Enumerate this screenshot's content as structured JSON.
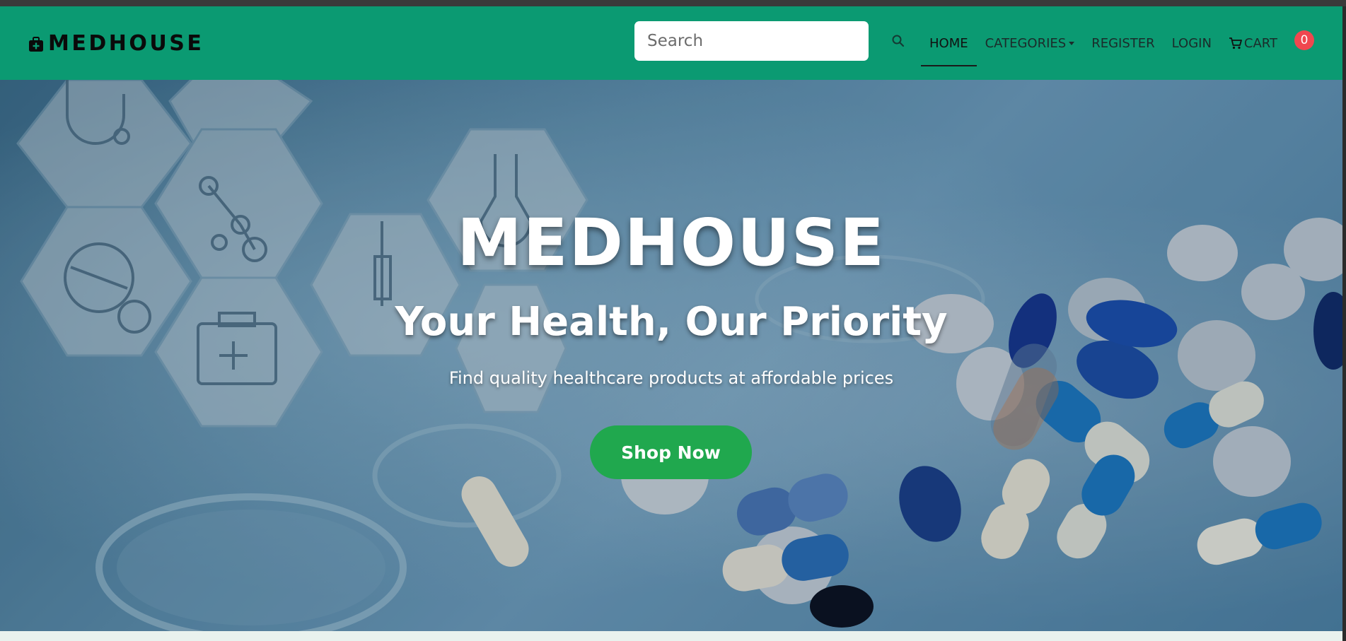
{
  "navbar": {
    "brand": "MEDHOUSE",
    "brand_icon": "medical-bag-icon",
    "search_placeholder": "Search",
    "search_icon": "search-icon",
    "links": {
      "home": "HOME",
      "categories": "CATEGORIES",
      "register": "REGISTER",
      "login": "LOGIN",
      "cart": "CART"
    },
    "cart_icon": "cart-icon",
    "cart_count": "0",
    "bg_color": "#0b9a72"
  },
  "hero": {
    "title": "MEDHOUSE",
    "subtitle": "Your Health, Our Priority",
    "tagline": "Find quality healthcare products at affordable prices",
    "cta_label": "Shop Now",
    "cta_color": "#20a84e"
  }
}
